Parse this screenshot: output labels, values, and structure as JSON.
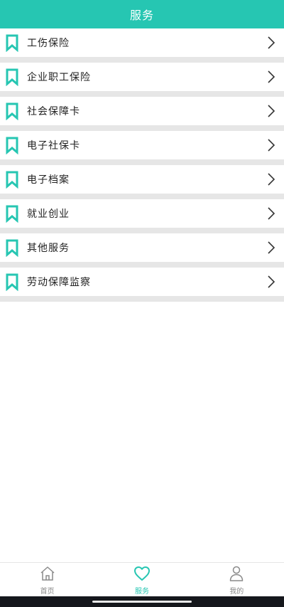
{
  "header": {
    "title": "服务"
  },
  "list": {
    "items": [
      {
        "label": "工伤保险"
      },
      {
        "label": "企业职工保险"
      },
      {
        "label": "社会保障卡"
      },
      {
        "label": "电子社保卡"
      },
      {
        "label": "电子档案"
      },
      {
        "label": "就业创业"
      },
      {
        "label": "其他服务"
      },
      {
        "label": "劳动保障监察"
      }
    ]
  },
  "tabbar": {
    "tabs": [
      {
        "label": "首页",
        "icon": "home-icon",
        "active": false
      },
      {
        "label": "服务",
        "icon": "heart-icon",
        "active": true
      },
      {
        "label": "我的",
        "icon": "user-icon",
        "active": false
      }
    ]
  },
  "colors": {
    "accent": "#26c6b2",
    "divider": "#e6e6e6",
    "inactive": "#8a8a8a"
  }
}
